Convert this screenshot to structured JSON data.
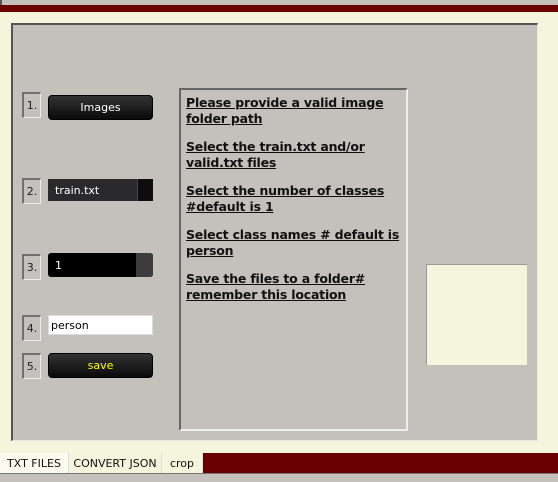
{
  "steps": {
    "n1": "1.",
    "n2": "2.",
    "n3": "3.",
    "n4": "4.",
    "n5": "5.",
    "images_button": "Images",
    "file_select": "train.txt",
    "classes_select": "1",
    "class_names_value": "person",
    "save_button": "save"
  },
  "instructions": [
    "Please provide a valid image folder path",
    "Select the train.txt and/or valid.txt files",
    "Select the number of classes #default is 1",
    "Select class names # default is person",
    "Save the files to a folder# remember this location"
  ],
  "tabs": [
    "TXT FILES",
    "CONVERT JSON",
    "crop"
  ],
  "colors": {
    "accent": "#6a0000",
    "panel": "#c4c0bc",
    "cream": "#f5f4dc",
    "save_text": "#ffff00"
  }
}
